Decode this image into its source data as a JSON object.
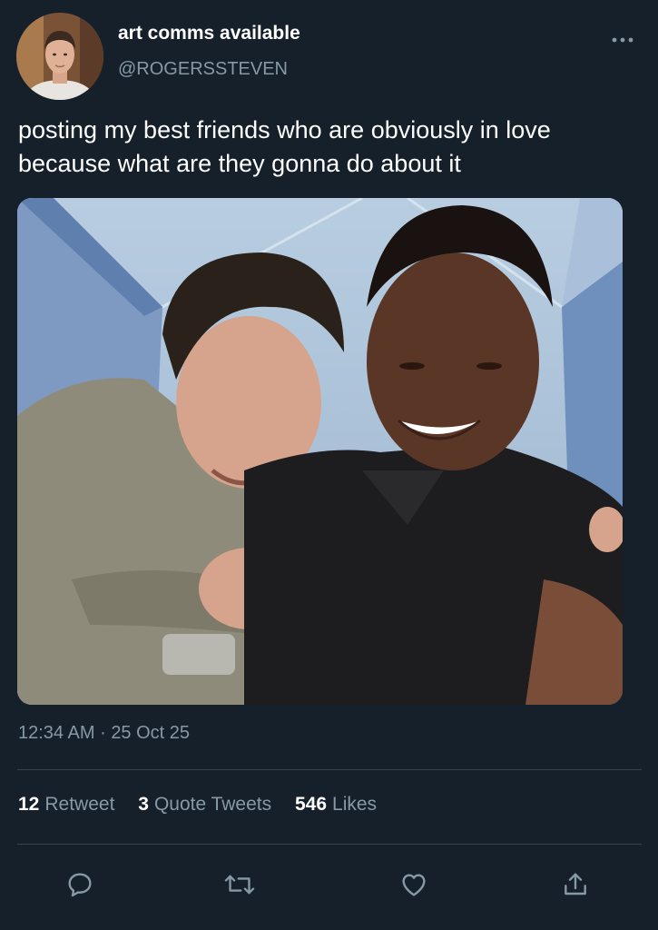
{
  "tweet": {
    "author": {
      "display_name": "art comms available",
      "handle": "@ROGERSSTEVEN",
      "avatar_icon": "profile-photo"
    },
    "text": "posting my best friends who are obviously in love\nbecause what are they gonna do about it",
    "time": "12:34 AM",
    "separator": "·",
    "date": "25 Oct 25",
    "stats": {
      "retweets": {
        "count": "12",
        "label": "Retweet"
      },
      "quotes": {
        "count": "3",
        "label": "Quote Tweets"
      },
      "likes": {
        "count": "546",
        "label": "Likes"
      }
    },
    "actions": [
      {
        "name": "reply",
        "icon": "reply-icon"
      },
      {
        "name": "retweet",
        "icon": "retweet-icon"
      },
      {
        "name": "like",
        "icon": "heart-icon"
      },
      {
        "name": "share",
        "icon": "share-icon"
      }
    ]
  },
  "theme": {
    "background": "#15202b",
    "text_primary": "#ffffff",
    "text_secondary": "#8899a6",
    "divider": "#38444d"
  }
}
